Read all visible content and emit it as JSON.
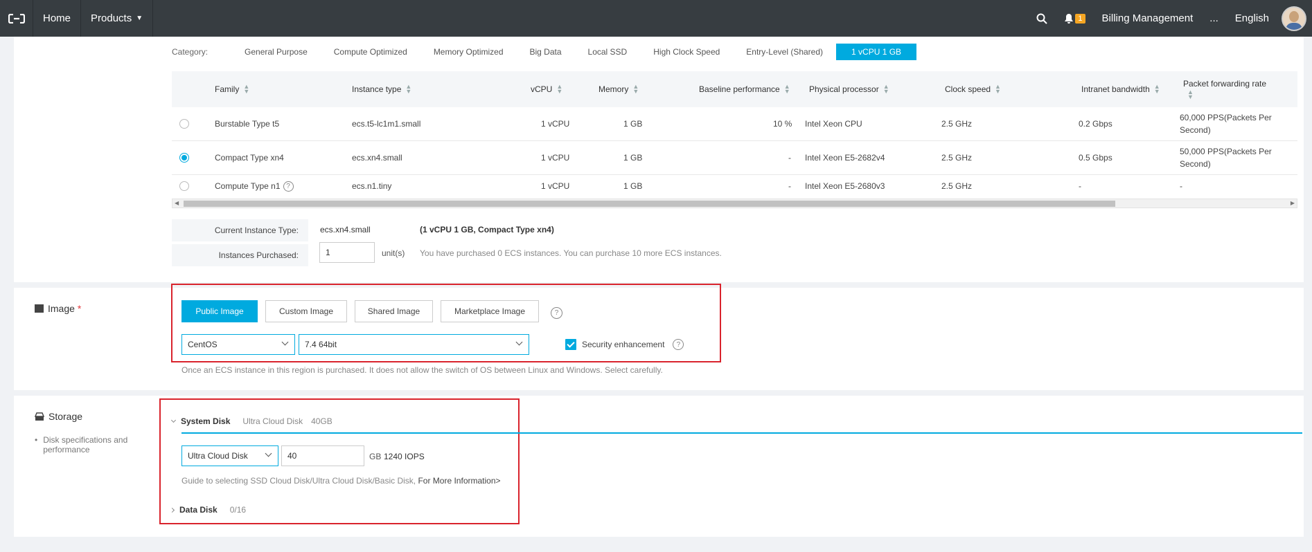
{
  "nav": {
    "home": "Home",
    "products": "Products",
    "notification_count": "1",
    "billing": "Billing Management",
    "more": "...",
    "language": "English"
  },
  "category": {
    "label": "Category:",
    "items": [
      "General Purpose",
      "Compute Optimized",
      "Memory Optimized",
      "Big Data",
      "Local SSD",
      "High Clock Speed",
      "Entry-Level (Shared)",
      "1 vCPU 1 GB"
    ],
    "active": "1 vCPU 1 GB"
  },
  "table": {
    "headers": {
      "family": "Family",
      "instance_type": "Instance type",
      "vcpu": "vCPU",
      "memory": "Memory",
      "baseline": "Baseline performance",
      "processor": "Physical processor",
      "clock": "Clock speed",
      "bandwidth": "Intranet bandwidth",
      "pps": "Packet forwarding rate"
    },
    "rows": [
      {
        "family": "Burstable Type t5",
        "type": "ecs.t5-lc1m1.small",
        "vcpu": "1 vCPU",
        "memory": "1 GB",
        "baseline": "10 %",
        "processor": "Intel Xeon CPU",
        "clock": "2.5 GHz",
        "bandwidth": "0.2 Gbps",
        "pps": "60,000 PPS(Packets Per Second)",
        "selected": false
      },
      {
        "family": "Compact Type xn4",
        "type": "ecs.xn4.small",
        "vcpu": "1 vCPU",
        "memory": "1 GB",
        "baseline": "-",
        "processor": "Intel Xeon E5-2682v4",
        "clock": "2.5 GHz",
        "bandwidth": "0.5 Gbps",
        "pps": "50,000 PPS(Packets Per Second)",
        "selected": true
      },
      {
        "family": "Compute Type n1",
        "type": "ecs.n1.tiny",
        "vcpu": "1 vCPU",
        "memory": "1 GB",
        "baseline": "-",
        "processor": "Intel Xeon E5-2680v3",
        "clock": "2.5 GHz",
        "bandwidth": "-",
        "pps": "-",
        "selected": false
      }
    ]
  },
  "current": {
    "label": "Current Instance Type:",
    "type": "ecs.xn4.small",
    "desc": "(1 vCPU 1 GB, Compact Type xn4)"
  },
  "purchase": {
    "label": "Instances Purchased:",
    "value": "1",
    "unit": "unit(s)",
    "note": "You have purchased 0 ECS instances. You can purchase 10 more ECS instances."
  },
  "image": {
    "title": "Image",
    "required": "*",
    "tabs": [
      "Public Image",
      "Custom Image",
      "Shared Image",
      "Marketplace Image"
    ],
    "os": "CentOS",
    "version": "7.4 64bit",
    "security_label": "Security enhancement",
    "note": "Once an ECS instance in this region is purchased. It does not allow the switch of OS between Linux and Windows. Select carefully."
  },
  "storage": {
    "title": "Storage",
    "bullet": "Disk specifications and performance",
    "system_disk_label": "System Disk",
    "system_disk_summary_type": "Ultra Cloud Disk",
    "system_disk_summary_size": "40GB",
    "disk_type": "Ultra Cloud Disk",
    "size": "40",
    "unit": "GB",
    "iops": "1240 IOPS",
    "guide": "Guide to selecting SSD Cloud Disk/Ultra Cloud Disk/Basic Disk,",
    "more_link": "For More Information>",
    "data_disk_label": "Data Disk",
    "data_disk_count": "0/16"
  },
  "colors": {
    "accent": "#00aadf",
    "nav": "#373d41",
    "highlight": "#d9232c"
  }
}
